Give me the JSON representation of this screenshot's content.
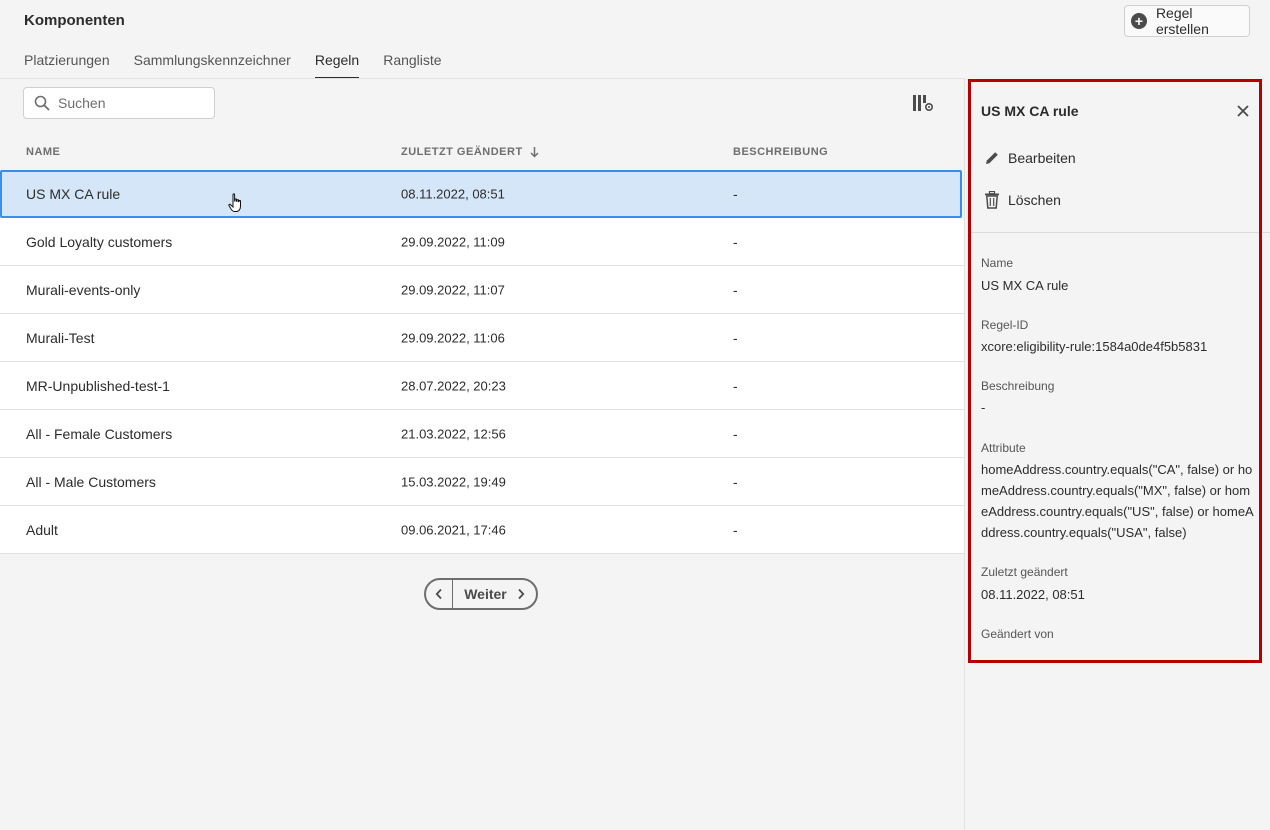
{
  "header": {
    "title": "Komponenten",
    "create_label": "Regel erstellen"
  },
  "tabs": [
    {
      "label": "Platzierungen",
      "active": false
    },
    {
      "label": "Sammlungskennzeichner",
      "active": false
    },
    {
      "label": "Regeln",
      "active": true
    },
    {
      "label": "Rangliste",
      "active": false
    }
  ],
  "search": {
    "placeholder": "Suchen",
    "value": ""
  },
  "table": {
    "columns": [
      "NAME",
      "ZULETZT GEÄNDERT",
      "BESCHREIBUNG"
    ],
    "sorted_column": "ZULETZT GEÄNDERT",
    "sort_direction": "descending",
    "rows": [
      {
        "name": "US MX CA rule",
        "modified": "08.11.2022, 08:51",
        "description": "-",
        "selected": true
      },
      {
        "name": "Gold Loyalty customers",
        "modified": "29.09.2022, 11:09",
        "description": "-"
      },
      {
        "name": "Murali-events-only",
        "modified": "29.09.2022, 11:07",
        "description": "-"
      },
      {
        "name": "Murali-Test",
        "modified": "29.09.2022, 11:06",
        "description": "-"
      },
      {
        "name": "MR-Unpublished-test-1",
        "modified": "28.07.2022, 20:23",
        "description": "-"
      },
      {
        "name": "All - Female Customers",
        "modified": "21.03.2022, 12:56",
        "description": "-"
      },
      {
        "name": "All - Male Customers",
        "modified": "15.03.2022, 19:49",
        "description": "-"
      },
      {
        "name": "Adult",
        "modified": "09.06.2021, 17:46",
        "description": "-"
      }
    ]
  },
  "pagination": {
    "next_label": "Weiter"
  },
  "panel": {
    "title": "US MX CA rule",
    "edit_label": "Bearbeiten",
    "delete_label": "Löschen",
    "name_label": "Name",
    "name_value": "US MX CA rule",
    "id_label": "Regel-ID",
    "id_value": "xcore:eligibility-rule:1584a0de4f5b5831",
    "desc_label": "Beschreibung",
    "desc_value": "-",
    "attr_label": "Attribute",
    "attr_value": "homeAddress.country.equals(\"CA\", false) or homeAddress.country.equals(\"MX\", false) or homeAddress.country.equals(\"US\", false) or homeAddress.country.equals(\"USA\", false)",
    "modified_label": "Zuletzt geändert",
    "modified_value": "08.11.2022, 08:51",
    "changed_by_label": "Geändert von"
  },
  "colors": {
    "selected_row_bg": "#d5e6f8",
    "selected_row_border": "#378ef0",
    "highlight_border": "#b40000"
  }
}
